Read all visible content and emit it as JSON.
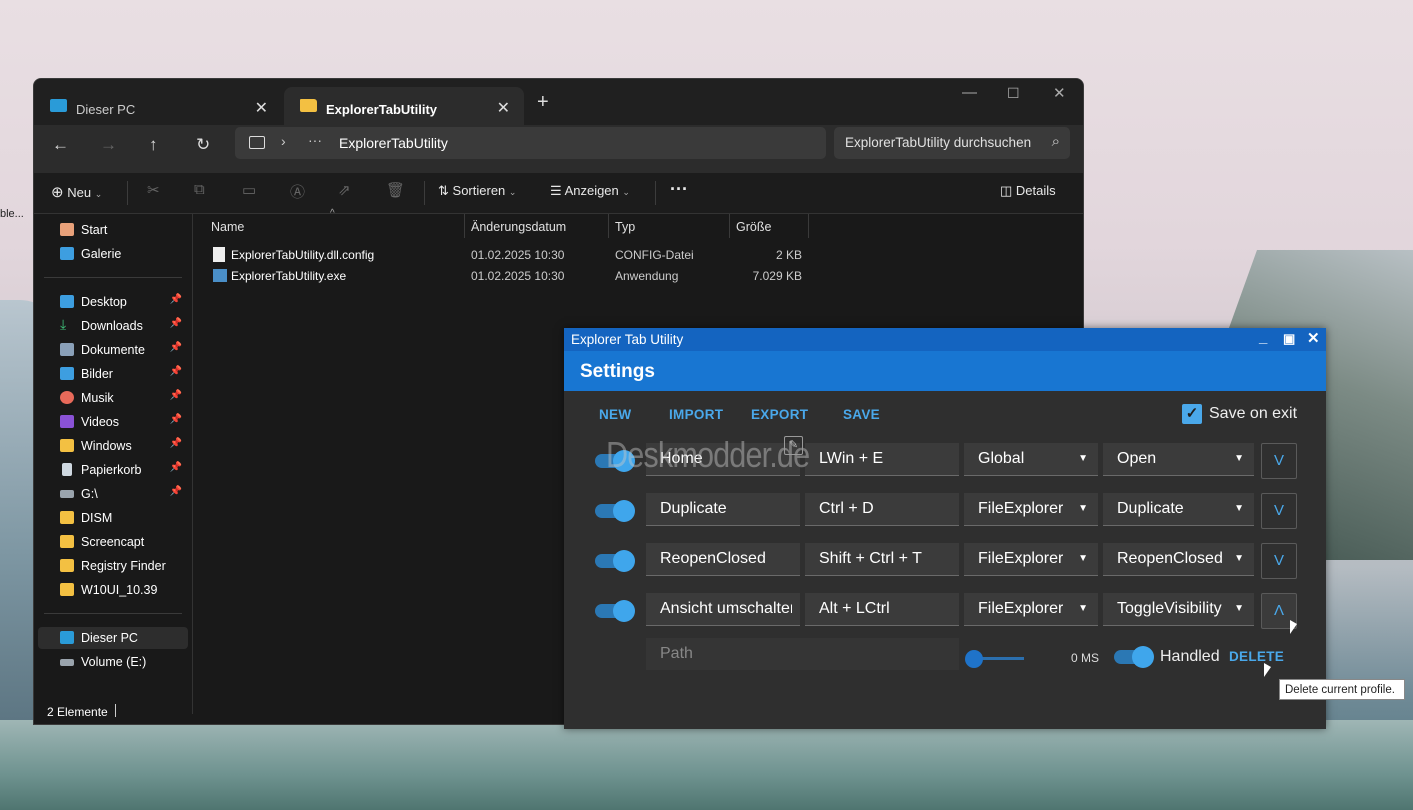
{
  "desktop": {
    "fragment_text": "ble..."
  },
  "explorer": {
    "tabs": [
      {
        "label": "Dieser PC"
      },
      {
        "label": "ExplorerTabUtility"
      }
    ],
    "address": {
      "path": "ExplorerTabUtility"
    },
    "search": {
      "placeholder": "ExplorerTabUtility durchsuchen"
    },
    "toolbar": {
      "new_label": "Neu",
      "sort_label": "Sortieren",
      "view_label": "Anzeigen",
      "details_label": "Details"
    },
    "sidebar": {
      "quick": [
        {
          "label": "Start"
        },
        {
          "label": "Galerie"
        }
      ],
      "pinned": [
        {
          "label": "Desktop"
        },
        {
          "label": "Downloads"
        },
        {
          "label": "Dokumente"
        },
        {
          "label": "Bilder"
        },
        {
          "label": "Musik"
        },
        {
          "label": "Videos"
        },
        {
          "label": "Windows"
        },
        {
          "label": "Papierkorb"
        },
        {
          "label": "G:\\"
        },
        {
          "label": "DISM"
        },
        {
          "label": "Screencapt"
        },
        {
          "label": "Registry Finder"
        },
        {
          "label": "W10UI_10.39"
        }
      ],
      "drives": [
        {
          "label": "Dieser PC"
        },
        {
          "label": "Volume (E:)"
        }
      ]
    },
    "columns": {
      "name": "Name",
      "date": "Änderungsdatum",
      "type": "Typ",
      "size": "Größe"
    },
    "files": [
      {
        "name": "ExplorerTabUtility.dll.config",
        "date": "01.02.2025 10:30",
        "type": "CONFIG-Datei",
        "size": "2 KB"
      },
      {
        "name": "ExplorerTabUtility.exe",
        "date": "01.02.2025 10:30",
        "type": "Anwendung",
        "size": "7.029 KB"
      }
    ],
    "status": "2 Elemente"
  },
  "settings": {
    "window_title": "Explorer Tab Utility",
    "header": "Settings",
    "actions": {
      "new": "NEW",
      "import": "IMPORT",
      "export": "EXPORT",
      "save": "SAVE"
    },
    "save_on_exit": "Save on exit",
    "watermark": "Deskmodder.de",
    "profiles": [
      {
        "name": "Home",
        "hotkey": "LWin + E",
        "scope": "Global",
        "action": "Open",
        "expand": "V"
      },
      {
        "name": "Duplicate",
        "hotkey": "Ctrl + D",
        "scope": "FileExplorer",
        "action": "Duplicate",
        "expand": "V"
      },
      {
        "name": "ReopenClosed",
        "hotkey": "Shift + Ctrl + T",
        "scope": "FileExplorer",
        "action": "ReopenClosed",
        "expand": "V"
      },
      {
        "name": "Ansicht umschalten",
        "hotkey": "Alt + LCtrl",
        "scope": "FileExplorer",
        "action": "ToggleVisibility",
        "expand": "Λ"
      }
    ],
    "detail": {
      "path_placeholder": "Path",
      "delay": "0 MS",
      "handled": "Handled",
      "delete": "DELETE"
    },
    "tooltip": "Delete current profile."
  },
  "colors": {
    "accent": "#1876d2",
    "link": "#4aa8ea",
    "toggle": "#3fa6ec"
  }
}
